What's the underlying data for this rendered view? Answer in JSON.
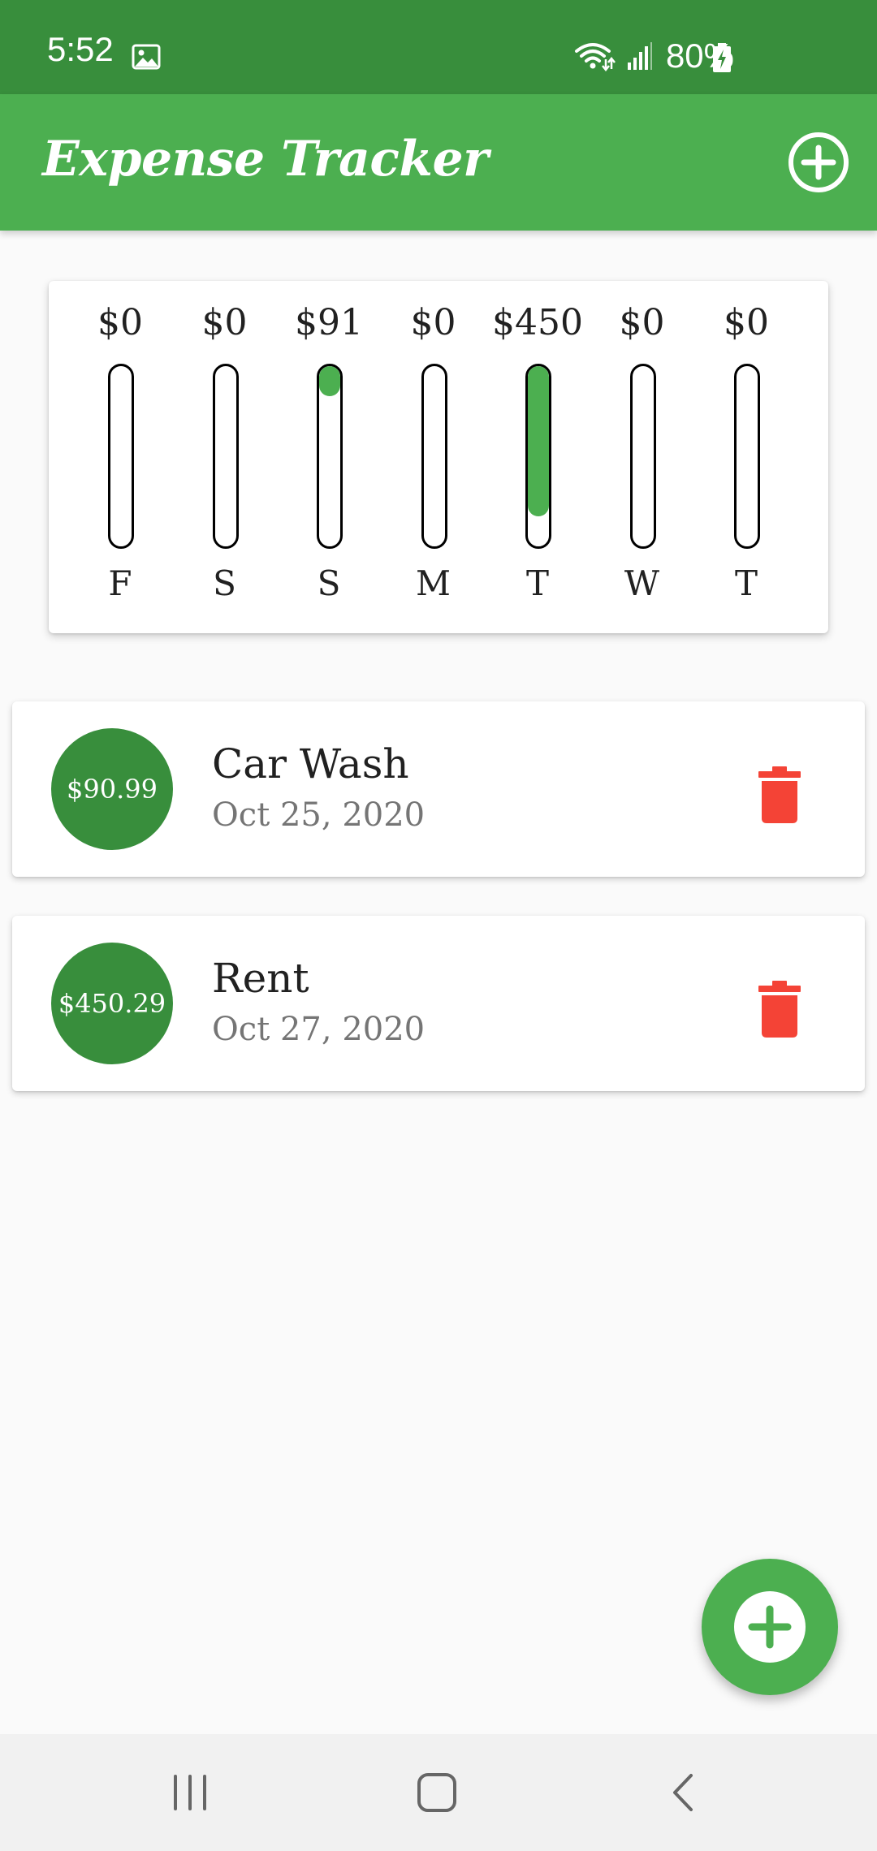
{
  "status_bar": {
    "time": "5:52",
    "battery": "80%",
    "icons": [
      "gallery-icon",
      "wifi-icon",
      "signal-icon",
      "battery-charging-icon"
    ]
  },
  "app_bar": {
    "title": "Expense Tracker",
    "add_icon": "add-circle-icon"
  },
  "chart_data": {
    "type": "bar",
    "categories": [
      "F",
      "S",
      "S",
      "M",
      "T",
      "W",
      "T"
    ],
    "value_labels": [
      "$0",
      "$0",
      "$91",
      "$0",
      "$450",
      "$0",
      "$0"
    ],
    "values": [
      0,
      0,
      90.99,
      0,
      450.29,
      0,
      0
    ],
    "fill_fraction": [
      0,
      0,
      0.168,
      0,
      0.832,
      0,
      0
    ],
    "fill_color": "#4caf50"
  },
  "transactions": [
    {
      "amount": "$90.99",
      "title": "Car Wash",
      "date": "Oct 25, 2020"
    },
    {
      "amount": "$450.29",
      "title": "Rent",
      "date": "Oct 27, 2020"
    }
  ],
  "colors": {
    "primary": "#4caf50",
    "primary_dark": "#388e3c",
    "delete": "#f44336",
    "background": "#fafafa"
  },
  "fab": {
    "icon": "add-icon"
  },
  "nav_bar": {
    "icons": [
      "recent-apps-icon",
      "home-icon",
      "back-icon"
    ]
  }
}
